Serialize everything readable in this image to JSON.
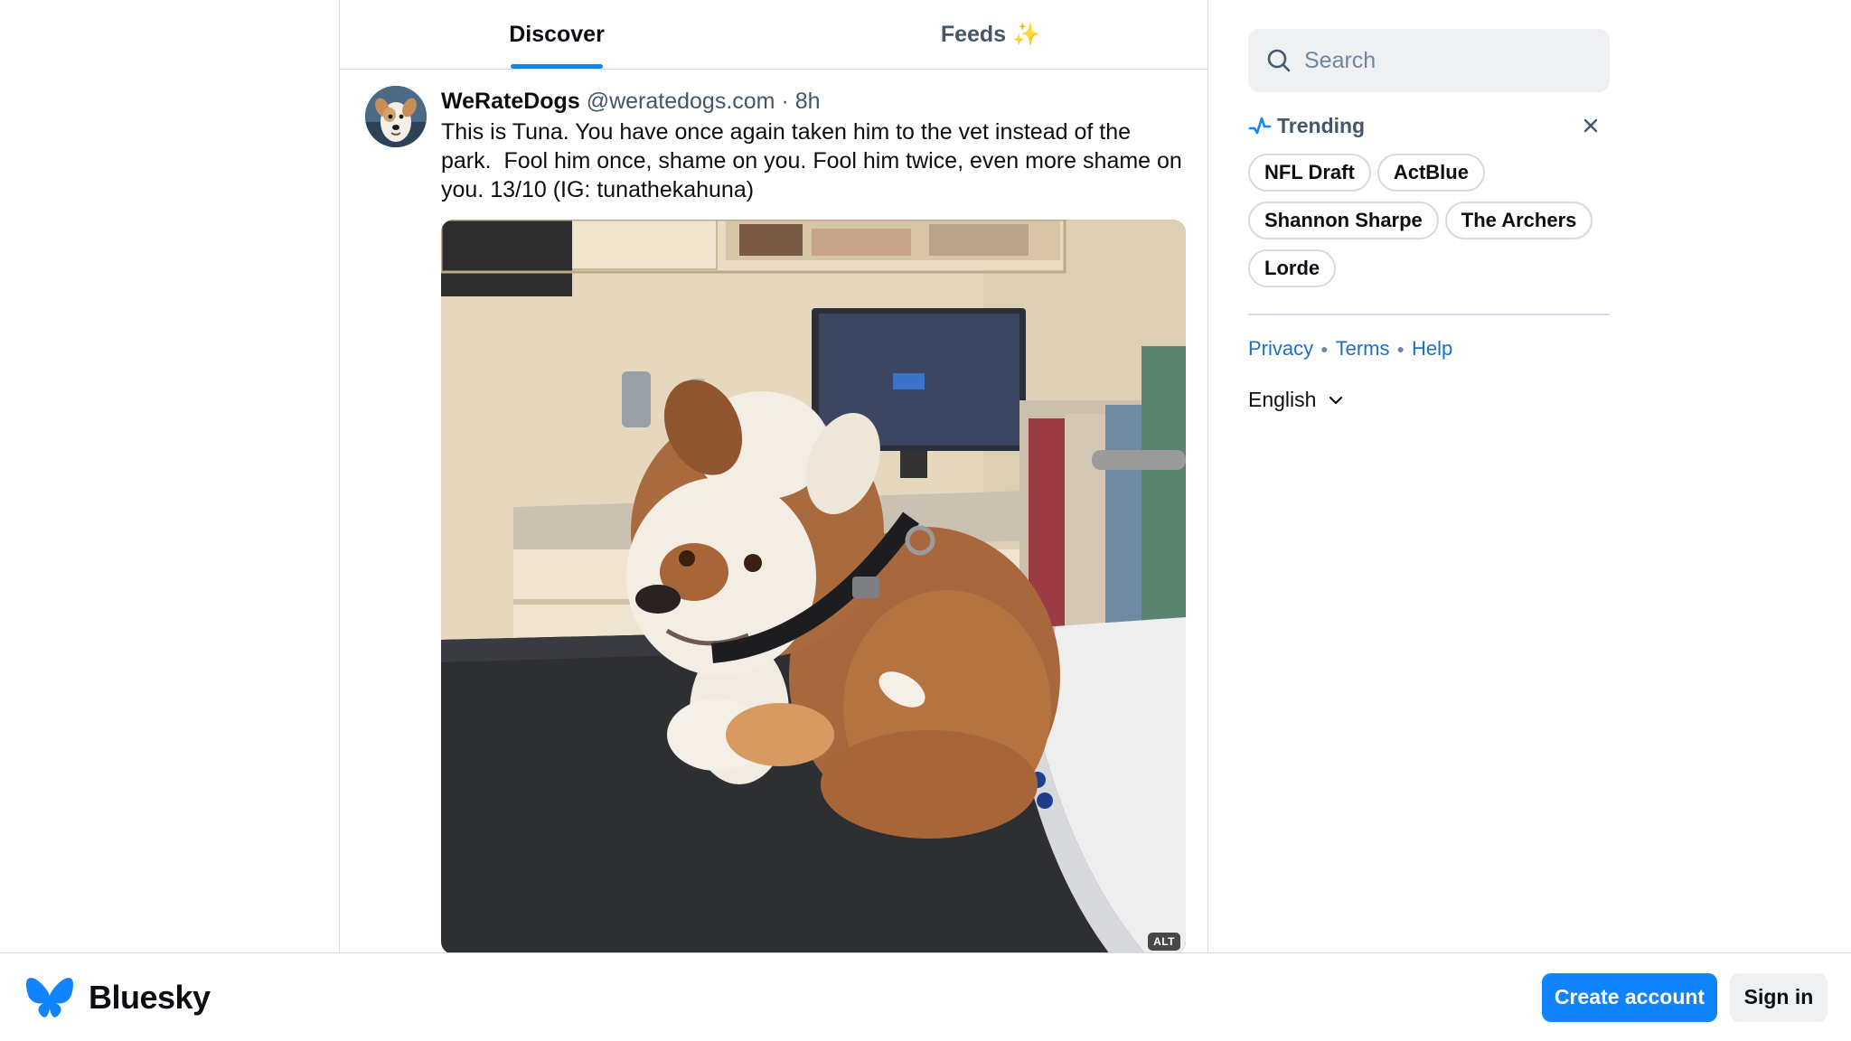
{
  "tabs": [
    {
      "label": "Discover",
      "active": true
    },
    {
      "label": "Feeds ✨",
      "active": false
    }
  ],
  "post": {
    "author_name": "WeRateDogs",
    "author_handle": "@weratedogs.com",
    "separator": " · ",
    "time": "8h",
    "text": "This is Tuna. You have once again taken him to the vet instead of the park.  Fool him once, shame on you. Fool him twice, even more shame on you. 13/10 (IG: tunathekahuna)",
    "image_alt_badge": "ALT",
    "avatar_icon": "dog-avatar"
  },
  "search": {
    "placeholder": "Search",
    "icon": "search-icon"
  },
  "trending": {
    "title": "Trending",
    "icon": "trending-icon",
    "close_icon": "close-icon",
    "topics": [
      "NFL Draft",
      "ActBlue",
      "Shannon Sharpe",
      "The Archers",
      "Lorde"
    ]
  },
  "footer": {
    "links": [
      "Privacy",
      "Terms",
      "Help"
    ],
    "language": "English"
  },
  "bottom_bar": {
    "brand": "Bluesky",
    "create_account": "Create account",
    "sign_in": "Sign in"
  },
  "colors": {
    "accent": "#1083fe",
    "link": "#1b6fc8",
    "muted_text": "#42576c",
    "border": "#d4dbe2"
  }
}
